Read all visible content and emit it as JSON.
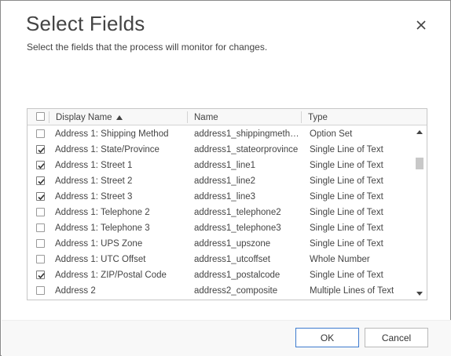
{
  "dialog": {
    "title": "Select Fields",
    "subtitle": "Select the fields that the process will monitor for changes."
  },
  "columns": {
    "display_name": "Display Name",
    "name": "Name",
    "type": "Type",
    "sort_direction": "ascending"
  },
  "rows": [
    {
      "display": "Address 1: Shipping Method",
      "name": "address1_shippingmethod...",
      "type": "Option Set",
      "checked": false
    },
    {
      "display": "Address 1: State/Province",
      "name": "address1_stateorprovince",
      "type": "Single Line of Text",
      "checked": true
    },
    {
      "display": "Address 1: Street 1",
      "name": "address1_line1",
      "type": "Single Line of Text",
      "checked": true
    },
    {
      "display": "Address 1: Street 2",
      "name": "address1_line2",
      "type": "Single Line of Text",
      "checked": true
    },
    {
      "display": "Address 1: Street 3",
      "name": "address1_line3",
      "type": "Single Line of Text",
      "checked": true
    },
    {
      "display": "Address 1: Telephone 2",
      "name": "address1_telephone2",
      "type": "Single Line of Text",
      "checked": false
    },
    {
      "display": "Address 1: Telephone 3",
      "name": "address1_telephone3",
      "type": "Single Line of Text",
      "checked": false
    },
    {
      "display": "Address 1: UPS Zone",
      "name": "address1_upszone",
      "type": "Single Line of Text",
      "checked": false
    },
    {
      "display": "Address 1: UTC Offset",
      "name": "address1_utcoffset",
      "type": "Whole Number",
      "checked": false
    },
    {
      "display": "Address 1: ZIP/Postal Code",
      "name": "address1_postalcode",
      "type": "Single Line of Text",
      "checked": true
    },
    {
      "display": "Address 2",
      "name": "address2_composite",
      "type": "Multiple Lines of Text",
      "checked": false
    }
  ],
  "buttons": {
    "ok": "OK",
    "cancel": "Cancel"
  },
  "colors": {
    "accent": "#3e7bcf",
    "title": "#444444"
  }
}
